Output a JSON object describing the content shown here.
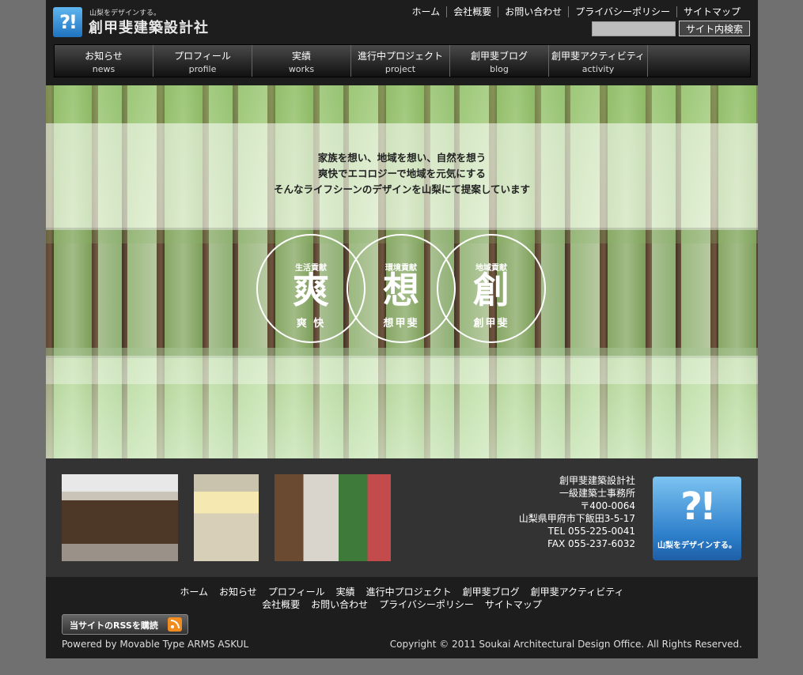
{
  "header": {
    "logo_mark": "?!",
    "logo_tagline": "山梨をデザインする。",
    "logo_name": "創甲斐建築設計社",
    "util_nav": [
      "ホーム",
      "会社概要",
      "お問い合わせ",
      "プライバシーポリシー",
      "サイトマップ"
    ],
    "search_placeholder": "",
    "search_button": "サイト内検索"
  },
  "main_nav": [
    {
      "jp": "お知らせ",
      "en": "news"
    },
    {
      "jp": "プロフィール",
      "en": "profile"
    },
    {
      "jp": "実績",
      "en": "works"
    },
    {
      "jp": "進行中プロジェクト",
      "en": "project"
    },
    {
      "jp": "創甲斐ブログ",
      "en": "blog"
    },
    {
      "jp": "創甲斐アクティビティ",
      "en": "activity"
    }
  ],
  "hero": {
    "lines": [
      "家族を想い、地域を想い、自然を想う",
      "爽快でエコロジーで地域を元気にする",
      "そんなライフシーンのデザインを山梨にて提案しています"
    ],
    "circles": [
      {
        "sub": "生活貢献",
        "big": "爽",
        "word": "爽 快"
      },
      {
        "sub": "環境貢献",
        "big": "想",
        "word": "想甲斐"
      },
      {
        "sub": "地域貢献",
        "big": "創",
        "word": "創甲斐"
      }
    ]
  },
  "info": {
    "address": [
      "創甲斐建築設計社",
      "一級建築士事務所",
      "〒400-0064",
      "山梨県甲府市下飯田3-5-17",
      "TEL 055-225-0041",
      "FAX 055-237-6032"
    ],
    "badge_mark": "?!",
    "badge_text": "山梨をデザインする。"
  },
  "footer": {
    "links_row1": [
      "ホーム",
      "お知らせ",
      "プロフィール",
      "実績",
      "進行中プロジェクト",
      "創甲斐ブログ",
      "創甲斐アクティビティ"
    ],
    "links_row2": [
      "会社概要",
      "お問い合わせ",
      "プライバシーポリシー",
      "サイトマップ"
    ],
    "rss_label": "当サイトのRSSを購読",
    "powered": "Powered by Movable Type ARMS ASKUL",
    "copyright": "Copyright © 2011 Soukai Architectural Design Office. All Rights Reserved."
  }
}
